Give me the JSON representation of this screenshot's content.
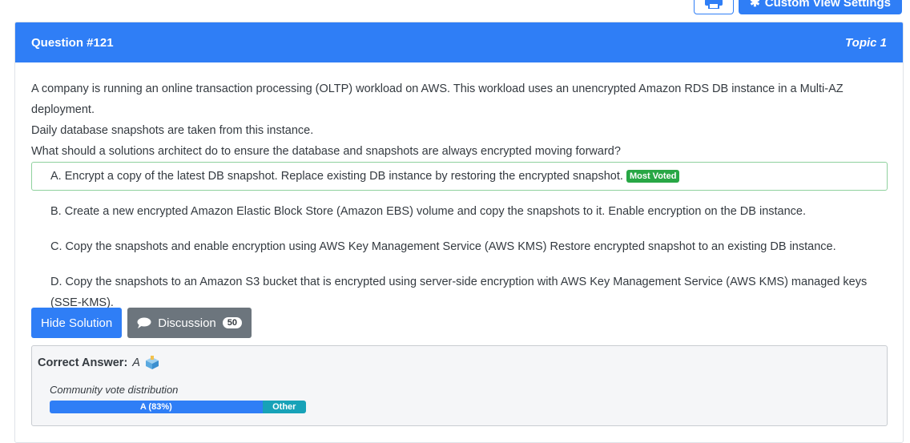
{
  "toolbar": {
    "print_icon": "printer-icon",
    "custom_label": "Custom View Settings",
    "custom_icon": "gear-icon"
  },
  "question": {
    "title": "Question #121",
    "topic": "Topic 1",
    "text_lines": [
      "A company is running an online transaction processing (OLTP) workload on AWS. This workload uses an unencrypted Amazon RDS DB instance in a Multi-AZ deployment.",
      "Daily database snapshots are taken from this instance.",
      "What should a solutions architect do to ensure the database and snapshots are always encrypted moving forward?"
    ]
  },
  "choices": [
    {
      "text": "A. Encrypt a copy of the latest DB snapshot. Replace existing DB instance by restoring the encrypted snapshot.",
      "badge": "Most Voted"
    },
    {
      "text": "B. Create a new encrypted Amazon Elastic Block Store (Amazon EBS) volume and copy the snapshots to it. Enable encryption on the DB instance."
    },
    {
      "text": "C. Copy the snapshots and enable encryption using AWS Key Management Service (AWS KMS) Restore encrypted snapshot to an existing DB instance."
    },
    {
      "text": "D. Copy the snapshots to an Amazon S3 bucket that is encrypted using server-side encryption with AWS Key Management Service (AWS KMS) managed keys (SSE-KMS)."
    }
  ],
  "buttons": {
    "hide_solution": "Hide Solution",
    "discussion": "Discussion",
    "discussion_count": "50",
    "discussion_icon": "chat-bubble-icon"
  },
  "answer": {
    "label": "Correct Answer:",
    "value": "A",
    "icon": "ballot-box-icon",
    "vote_label": "Community vote distribution",
    "votes": [
      {
        "label": "A (83%)",
        "fraction": 0.83,
        "color": "#2f7ef6"
      },
      {
        "label": "Other",
        "fraction": 0.17,
        "color": "#17a2b8"
      }
    ]
  }
}
